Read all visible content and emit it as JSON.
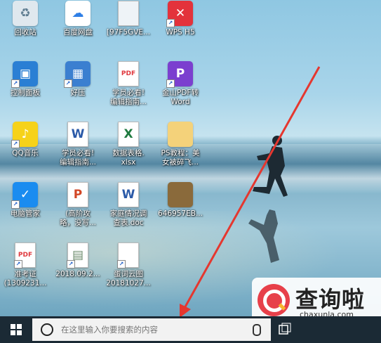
{
  "desktop": {
    "icons": [
      {
        "label": "回收站",
        "icon": "recycle-bin-icon",
        "color": "#dfe8ee"
      },
      {
        "label": "百度网盘",
        "icon": "baidu-netdisk-icon",
        "color": "#ffffff"
      },
      {
        "label": "[97F5GVE...",
        "icon": "file-icon",
        "color": "#eef3f7"
      },
      {
        "label": "WPS H5",
        "icon": "wps-h5-icon",
        "color": "#e3323b"
      },
      {
        "label": "控制面板",
        "icon": "control-panel-icon",
        "color": "#2a7fd4"
      },
      {
        "label": "好压",
        "icon": "haozip-icon",
        "color": "#3b7fd0"
      },
      {
        "label": "学员必看!\n编辑指南...",
        "icon": "pdf-icon",
        "color": "#ffffff"
      },
      {
        "label": "金山PDF转\nWord",
        "icon": "kingsoft-pdf-icon",
        "color": "#7b3fcf"
      },
      {
        "label": "QQ音乐",
        "icon": "qq-music-icon",
        "color": "#f6d21a"
      },
      {
        "label": "学员必看!\n编辑指南...",
        "icon": "word-doc-icon",
        "color": "#ffffff"
      },
      {
        "label": "数据表格.\nxlsx",
        "icon": "excel-icon",
        "color": "#ffffff"
      },
      {
        "label": "PS教程：美\n女被碎飞...",
        "icon": "folder-icon",
        "color": "#f4d27a"
      },
      {
        "label": "电脑管家",
        "icon": "pc-manager-icon",
        "color": "#1a8cf0"
      },
      {
        "label": "(高阶攻\n略，没写...",
        "icon": "ppt-icon",
        "color": "#ffffff"
      },
      {
        "label": "家庭情况调\n查表.doc",
        "icon": "word-doc-icon",
        "color": "#ffffff"
      },
      {
        "label": "646957EB...",
        "icon": "image-icon",
        "color": "#8a6a3b"
      },
      {
        "label": "准考证\n(1309231...",
        "icon": "pdf-icon",
        "color": "#ffffff"
      },
      {
        "label": "2018.09.2...",
        "icon": "image-file-icon",
        "color": "#ffffff"
      },
      {
        "label": "蛋词云图\n20181027...",
        "icon": "blank-file-icon",
        "color": "#ffffff"
      }
    ]
  },
  "taskbar": {
    "search_placeholder": "在这里输入你要搜索的内容"
  },
  "watermark": {
    "title": "查询啦",
    "url": "chaxunla.com"
  },
  "annotation": {
    "arrow_color": "#e5372f"
  }
}
